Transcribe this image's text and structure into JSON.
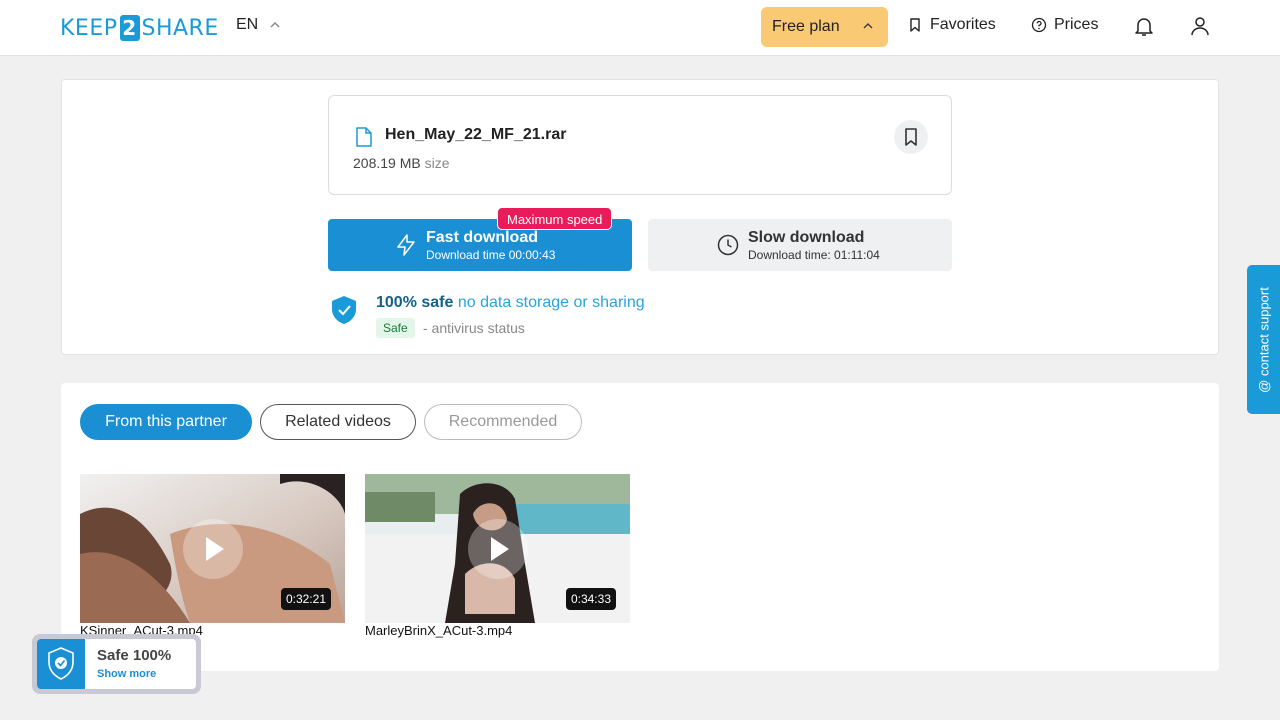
{
  "header": {
    "logo_left": "KEEP",
    "logo_mid": "2",
    "logo_right": "SHARE",
    "language": "EN",
    "plan_label": "Free plan",
    "favorites_label": "Favorites",
    "prices_label": "Prices",
    "icons": [
      "chevron-up-icon",
      "bookmark-icon",
      "question-icon",
      "bell-icon",
      "user-icon"
    ]
  },
  "file": {
    "name": "Hen_May_22_MF_21.rar",
    "size_value": "208.19 MB",
    "size_label": "size"
  },
  "download": {
    "fast_title": "Fast download",
    "fast_time": "Download time 00:00:43",
    "badge": "Maximum speed",
    "slow_title": "Slow download",
    "slow_time": "Download time: 01:11:04"
  },
  "security": {
    "safe_strong": "100% safe",
    "safe_rest": "no data storage or sharing",
    "tag": "Safe",
    "status": "- antivirus status"
  },
  "tabs": [
    {
      "label": "From this partner",
      "state": "active"
    },
    {
      "label": "Related videos",
      "state": "normal"
    },
    {
      "label": "Recommended",
      "state": "disabled"
    }
  ],
  "videos": [
    {
      "name": "KSinner_ACut-3.mp4",
      "duration": "0:32:21"
    },
    {
      "name": "MarleyBrinX_ACut-3.mp4",
      "duration": "0:34:33"
    }
  ],
  "safe_widget": {
    "title": "Safe 100%",
    "link": "Show more"
  },
  "support": {
    "label": "@ contact support"
  },
  "colors": {
    "brand_blue": "#1a8fd4",
    "plan_yellow": "#f9c974",
    "badge_pink": "#e81c5b",
    "safe_green_bg": "#e4f6ea"
  }
}
